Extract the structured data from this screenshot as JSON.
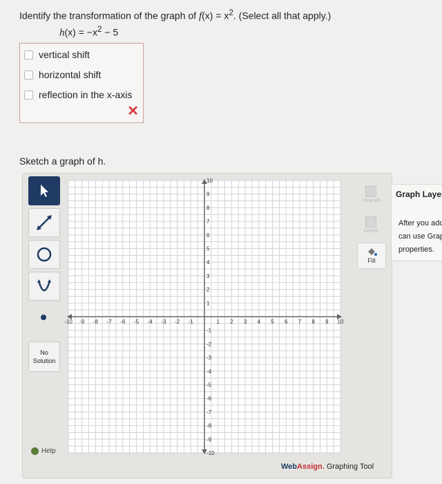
{
  "question": {
    "prefix": "Identify the transformation of the graph of ",
    "fname": "f",
    "fx_rest": "(x) = x",
    "exp": "2",
    "suffix": ". (Select all that apply.)",
    "h_label": "h",
    "h_rest": "(x) = −x",
    "h_exp": "2",
    "h_tail": " − 5"
  },
  "choices": [
    {
      "label": "vertical shift",
      "checked": false
    },
    {
      "label": "horizontal shift",
      "checked": false
    },
    {
      "label": "reflection in the x-axis",
      "checked": false
    }
  ],
  "feedback": {
    "mark": "✕",
    "color": "#d83a3a"
  },
  "sketch_prompt": "Sketch a graph of h.",
  "tools": {
    "pointer": "pointer-icon",
    "line": "line-icon",
    "circle": "circle-icon",
    "parabola": "parabola-icon",
    "point": "point-icon",
    "no_solution": "No Solution",
    "help": "Help"
  },
  "graph": {
    "x_range": [
      -10,
      10
    ],
    "y_range": [
      -10,
      10
    ],
    "x_ticks": [
      "-10",
      "-9",
      "-8",
      "-7",
      "-6",
      "-5",
      "-4",
      "-3",
      "-2",
      "-1",
      "1",
      "2",
      "3",
      "4",
      "5",
      "6",
      "7",
      "8",
      "9",
      "10"
    ],
    "y_ticks": [
      "10",
      "9",
      "8",
      "7",
      "6",
      "5",
      "4",
      "3",
      "2",
      "1",
      "-1",
      "-2",
      "-3",
      "-4",
      "-5",
      "-6",
      "-7",
      "-8",
      "-9",
      "-10"
    ]
  },
  "right_tools": {
    "clear": "Clear All",
    "delete": "Delete",
    "fill": "Fill"
  },
  "brand": {
    "part1": "Web",
    "part2": "Assign",
    "part3": ". Graphing Tool"
  },
  "layers": {
    "title": "Graph Layers",
    "hint_line1": "After you add an object to the graph you",
    "hint_line2": "can use Graph Layers to view and edit its",
    "hint_line3": "properties."
  },
  "colors": {
    "accent": "#1f3b63",
    "error": "#d83a3a"
  }
}
